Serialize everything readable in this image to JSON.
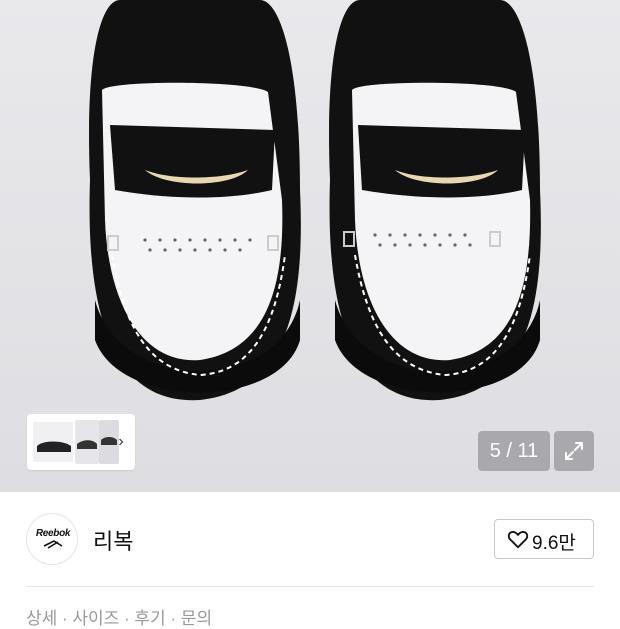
{
  "gallery": {
    "counter": "5 / 11",
    "thumb_arrow": "›"
  },
  "brand": {
    "logo_text": "Reebok",
    "name": "리복"
  },
  "like": {
    "count": "9.6만"
  },
  "bottom": {
    "partial_text": "상세 · 사이즈 · 후기 · 문의"
  }
}
